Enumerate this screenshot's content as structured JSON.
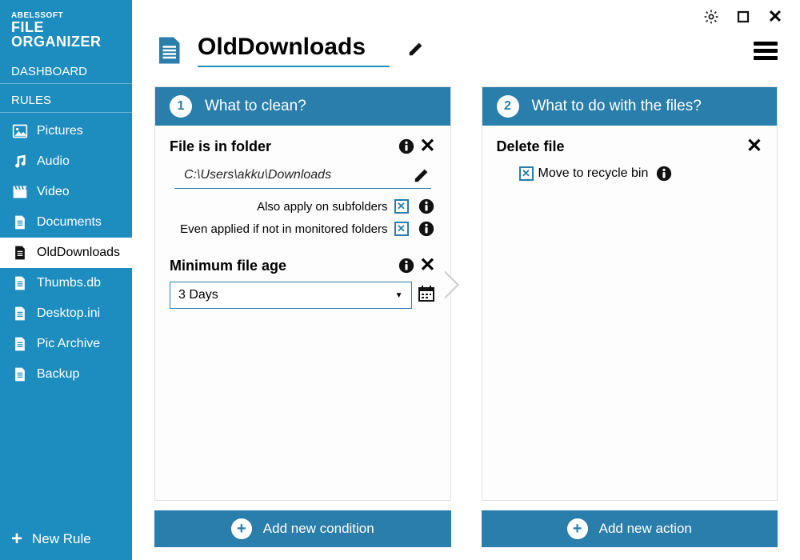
{
  "brand": {
    "top": "ABELSSOFT",
    "main": "FILE ORGANIZER"
  },
  "nav": {
    "dashboard": "DASHBOARD",
    "rules_title": "RULES",
    "items": [
      {
        "label": "Pictures",
        "icon": "image"
      },
      {
        "label": "Audio",
        "icon": "music"
      },
      {
        "label": "Video",
        "icon": "clapper"
      },
      {
        "label": "Documents",
        "icon": "doc"
      },
      {
        "label": "OldDownloads",
        "icon": "doc",
        "active": true
      },
      {
        "label": "Thumbs.db",
        "icon": "doc"
      },
      {
        "label": "Desktop.ini",
        "icon": "doc"
      },
      {
        "label": "Pic Archive",
        "icon": "doc"
      },
      {
        "label": "Backup",
        "icon": "doc"
      }
    ],
    "new_rule": "New Rule"
  },
  "header": {
    "title": "OldDownloads"
  },
  "panel1": {
    "step": "1",
    "title": "What to clean?",
    "folder": {
      "heading": "File is in folder",
      "path": "C:\\Users\\akku\\Downloads",
      "opt_subfolders": "Also apply on subfolders",
      "opt_unmonitored": "Even applied if not in monitored folders"
    },
    "age": {
      "heading": "Minimum file age",
      "value": "3 Days"
    },
    "add_button": "Add new condition"
  },
  "panel2": {
    "step": "2",
    "title": "What to do with the files?",
    "delete": {
      "heading": "Delete file",
      "opt_recycle": "Move to recycle bin"
    },
    "add_button": "Add new action"
  }
}
